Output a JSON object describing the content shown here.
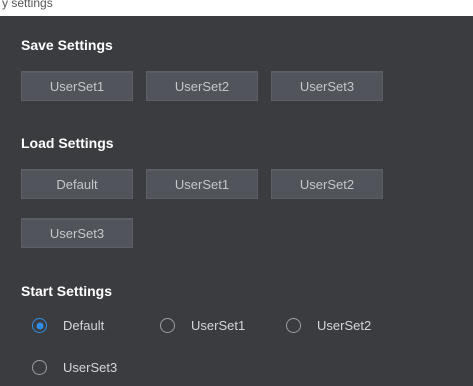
{
  "header_fragment": "y settings",
  "save": {
    "title": "Save Settings",
    "buttons": [
      "UserSet1",
      "UserSet2",
      "UserSet3"
    ]
  },
  "load": {
    "title": "Load Settings",
    "buttons": [
      "Default",
      "UserSet1",
      "UserSet2",
      "UserSet3"
    ]
  },
  "start": {
    "title": "Start Settings",
    "options": [
      "Default",
      "UserSet1",
      "UserSet2",
      "UserSet3"
    ],
    "selected": "Default"
  },
  "colors": {
    "background": "#3b3c40",
    "button": "#51545a",
    "accent": "#2f8ee8"
  }
}
